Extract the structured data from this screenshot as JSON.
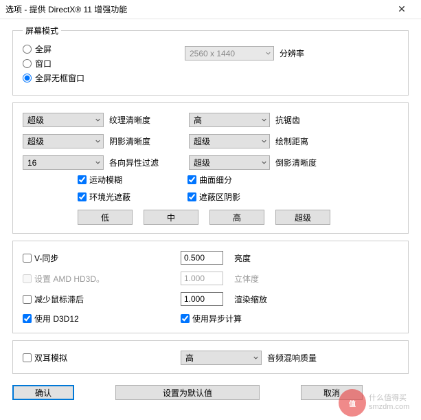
{
  "window": {
    "title": "选项 - 提供 DirectX® 11 增强功能"
  },
  "screen": {
    "legend": "屏幕模式",
    "opts": {
      "fullscreen": "全屏",
      "window": "窗口",
      "borderless": "全屏无框窗口"
    },
    "resolution": "2560 x 1440",
    "res_label": "分辨率"
  },
  "gfx": {
    "texture_val": "超级",
    "texture_lbl": "纹理清晰度",
    "aa_val": "高",
    "aa_lbl": "抗锯齿",
    "shadow_val": "超级",
    "shadow_lbl": "阴影清晰度",
    "draw_val": "超级",
    "draw_lbl": "绘制距离",
    "aniso_val": "16",
    "aniso_lbl": "各向异性过滤",
    "reflect_val": "超级",
    "reflect_lbl": "倒影清晰度",
    "cb_motion": "运动模糊",
    "cb_tess": "曲面细分",
    "cb_ao": "环境光遮蔽",
    "cb_shadowarea": "遮蔽区阴影",
    "preset_low": "低",
    "preset_mid": "中",
    "preset_high": "高",
    "preset_ultra": "超级"
  },
  "misc": {
    "vsync": "V-同步",
    "brightness_val": "0.500",
    "brightness_lbl": "亮度",
    "hd3d": "设置 AMD HD3D。",
    "stereo_val": "1.000",
    "stereo_lbl": "立体度",
    "mouse": "减少鼠标滞后",
    "render_val": "1.000",
    "render_lbl": "渲染缩放",
    "d3d12": "使用 D3D12",
    "async": "使用异步计算"
  },
  "audio": {
    "binaural": "双耳模拟",
    "quality_val": "高",
    "quality_lbl": "音频混响质量"
  },
  "buttons": {
    "ok": "确认",
    "defaults": "设置为默认值",
    "cancel": "取消"
  },
  "watermark": {
    "badge": "值",
    "line1": "什么值得买",
    "line2": "smzdm.com"
  }
}
